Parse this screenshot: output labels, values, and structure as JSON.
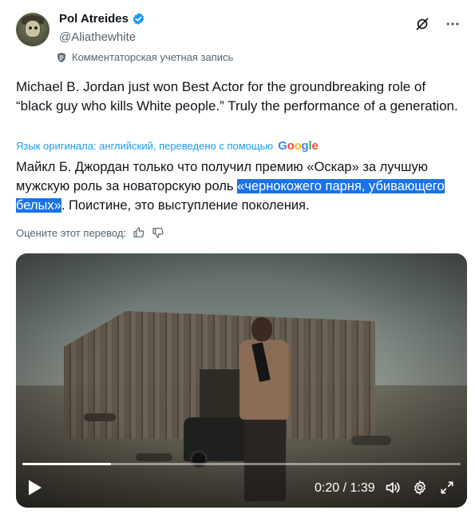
{
  "author": {
    "display_name": "Pol Atreides",
    "handle": "@Aliathewhite",
    "community_label": "Комментаторская учетная запись"
  },
  "icons": {
    "verified": "verified-badge-icon",
    "no-translate": "no-translate-icon",
    "more": "more-options-icon",
    "community": "shield-icon",
    "like": "thumbs-up-icon",
    "dislike": "thumbs-down-icon",
    "play": "play-icon",
    "volume": "volume-icon",
    "settings": "gear-icon",
    "fullscreen": "fullscreen-icon"
  },
  "colors": {
    "accent": "#1d9bf0",
    "highlight": "#1a73e8",
    "muted_text": "#536471"
  },
  "tweet": {
    "original_text": "Michael B. Jordan just won Best Actor for the groundbreaking role of “black guy who kills White people.” Truly the performance of a generation.",
    "translation_note": "Язык оригинала: английский, переведено с помощью",
    "translator_brand": "Google",
    "translated_before": "Майкл Б. Джордан только что получил премию «Оскар» за лучшую мужскую роль за новаторскую роль ",
    "translated_highlight": "«чернокожего парня, убивающего белых»",
    "translated_after": ". Поистине, это выступление поколения.",
    "rate_label": "Оцените этот перевод:"
  },
  "video": {
    "time_display": "0:20 / 1:39",
    "progress_fraction": 0.202
  }
}
